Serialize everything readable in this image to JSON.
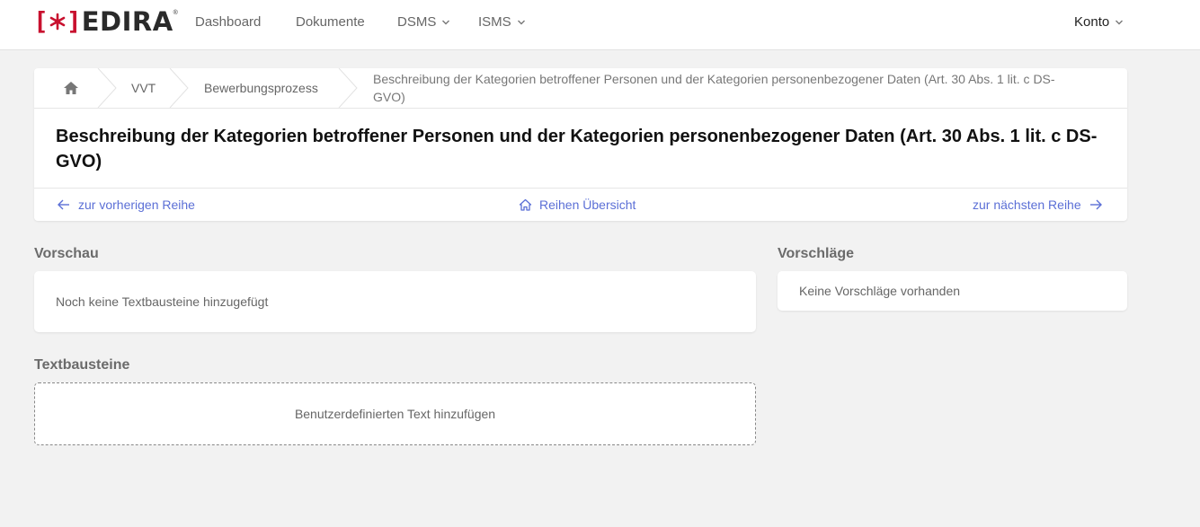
{
  "brand": {
    "bracket_left": "[",
    "bracket_right": "]",
    "name": "EDIRA",
    "registered": "®",
    "accent_color": "#c8102e"
  },
  "nav": {
    "items": [
      {
        "label": "Dashboard",
        "has_dropdown": false
      },
      {
        "label": "Dokumente",
        "has_dropdown": false
      },
      {
        "label": "DSMS",
        "has_dropdown": true
      },
      {
        "label": "ISMS",
        "has_dropdown": true
      }
    ],
    "account_label": "Konto"
  },
  "breadcrumb": {
    "home_icon": "home-icon",
    "items": [
      "VVT",
      "Bewerbungsprozess"
    ],
    "current_line1": "Beschreibung der Kategorien betroffener Personen und der Kategorien personenbezogener Daten (Art. 30 Abs. 1 lit. c DS-",
    "current_line2": "GVO)"
  },
  "page": {
    "title_line1": "Beschreibung der Kategorien betroffener Personen und der Kategorien personenbezogener Daten (Art. 30 Abs. 1 lit. c DS-",
    "title_line2": "GVO)"
  },
  "row_nav": {
    "prev_label": "zur vorherigen Reihe",
    "overview_label": "Reihen Übersicht",
    "next_label": "zur nächsten Reihe",
    "link_color": "#5b6fd6"
  },
  "preview": {
    "heading": "Vorschau",
    "empty_text": "Noch keine Textbausteine hinzugefügt"
  },
  "suggestions": {
    "heading": "Vorschläge",
    "empty_text": "Keine Vorschläge vorhanden"
  },
  "textblocks": {
    "heading": "Textbausteine",
    "add_custom_label": "Benutzerdefinierten Text hinzufügen"
  }
}
